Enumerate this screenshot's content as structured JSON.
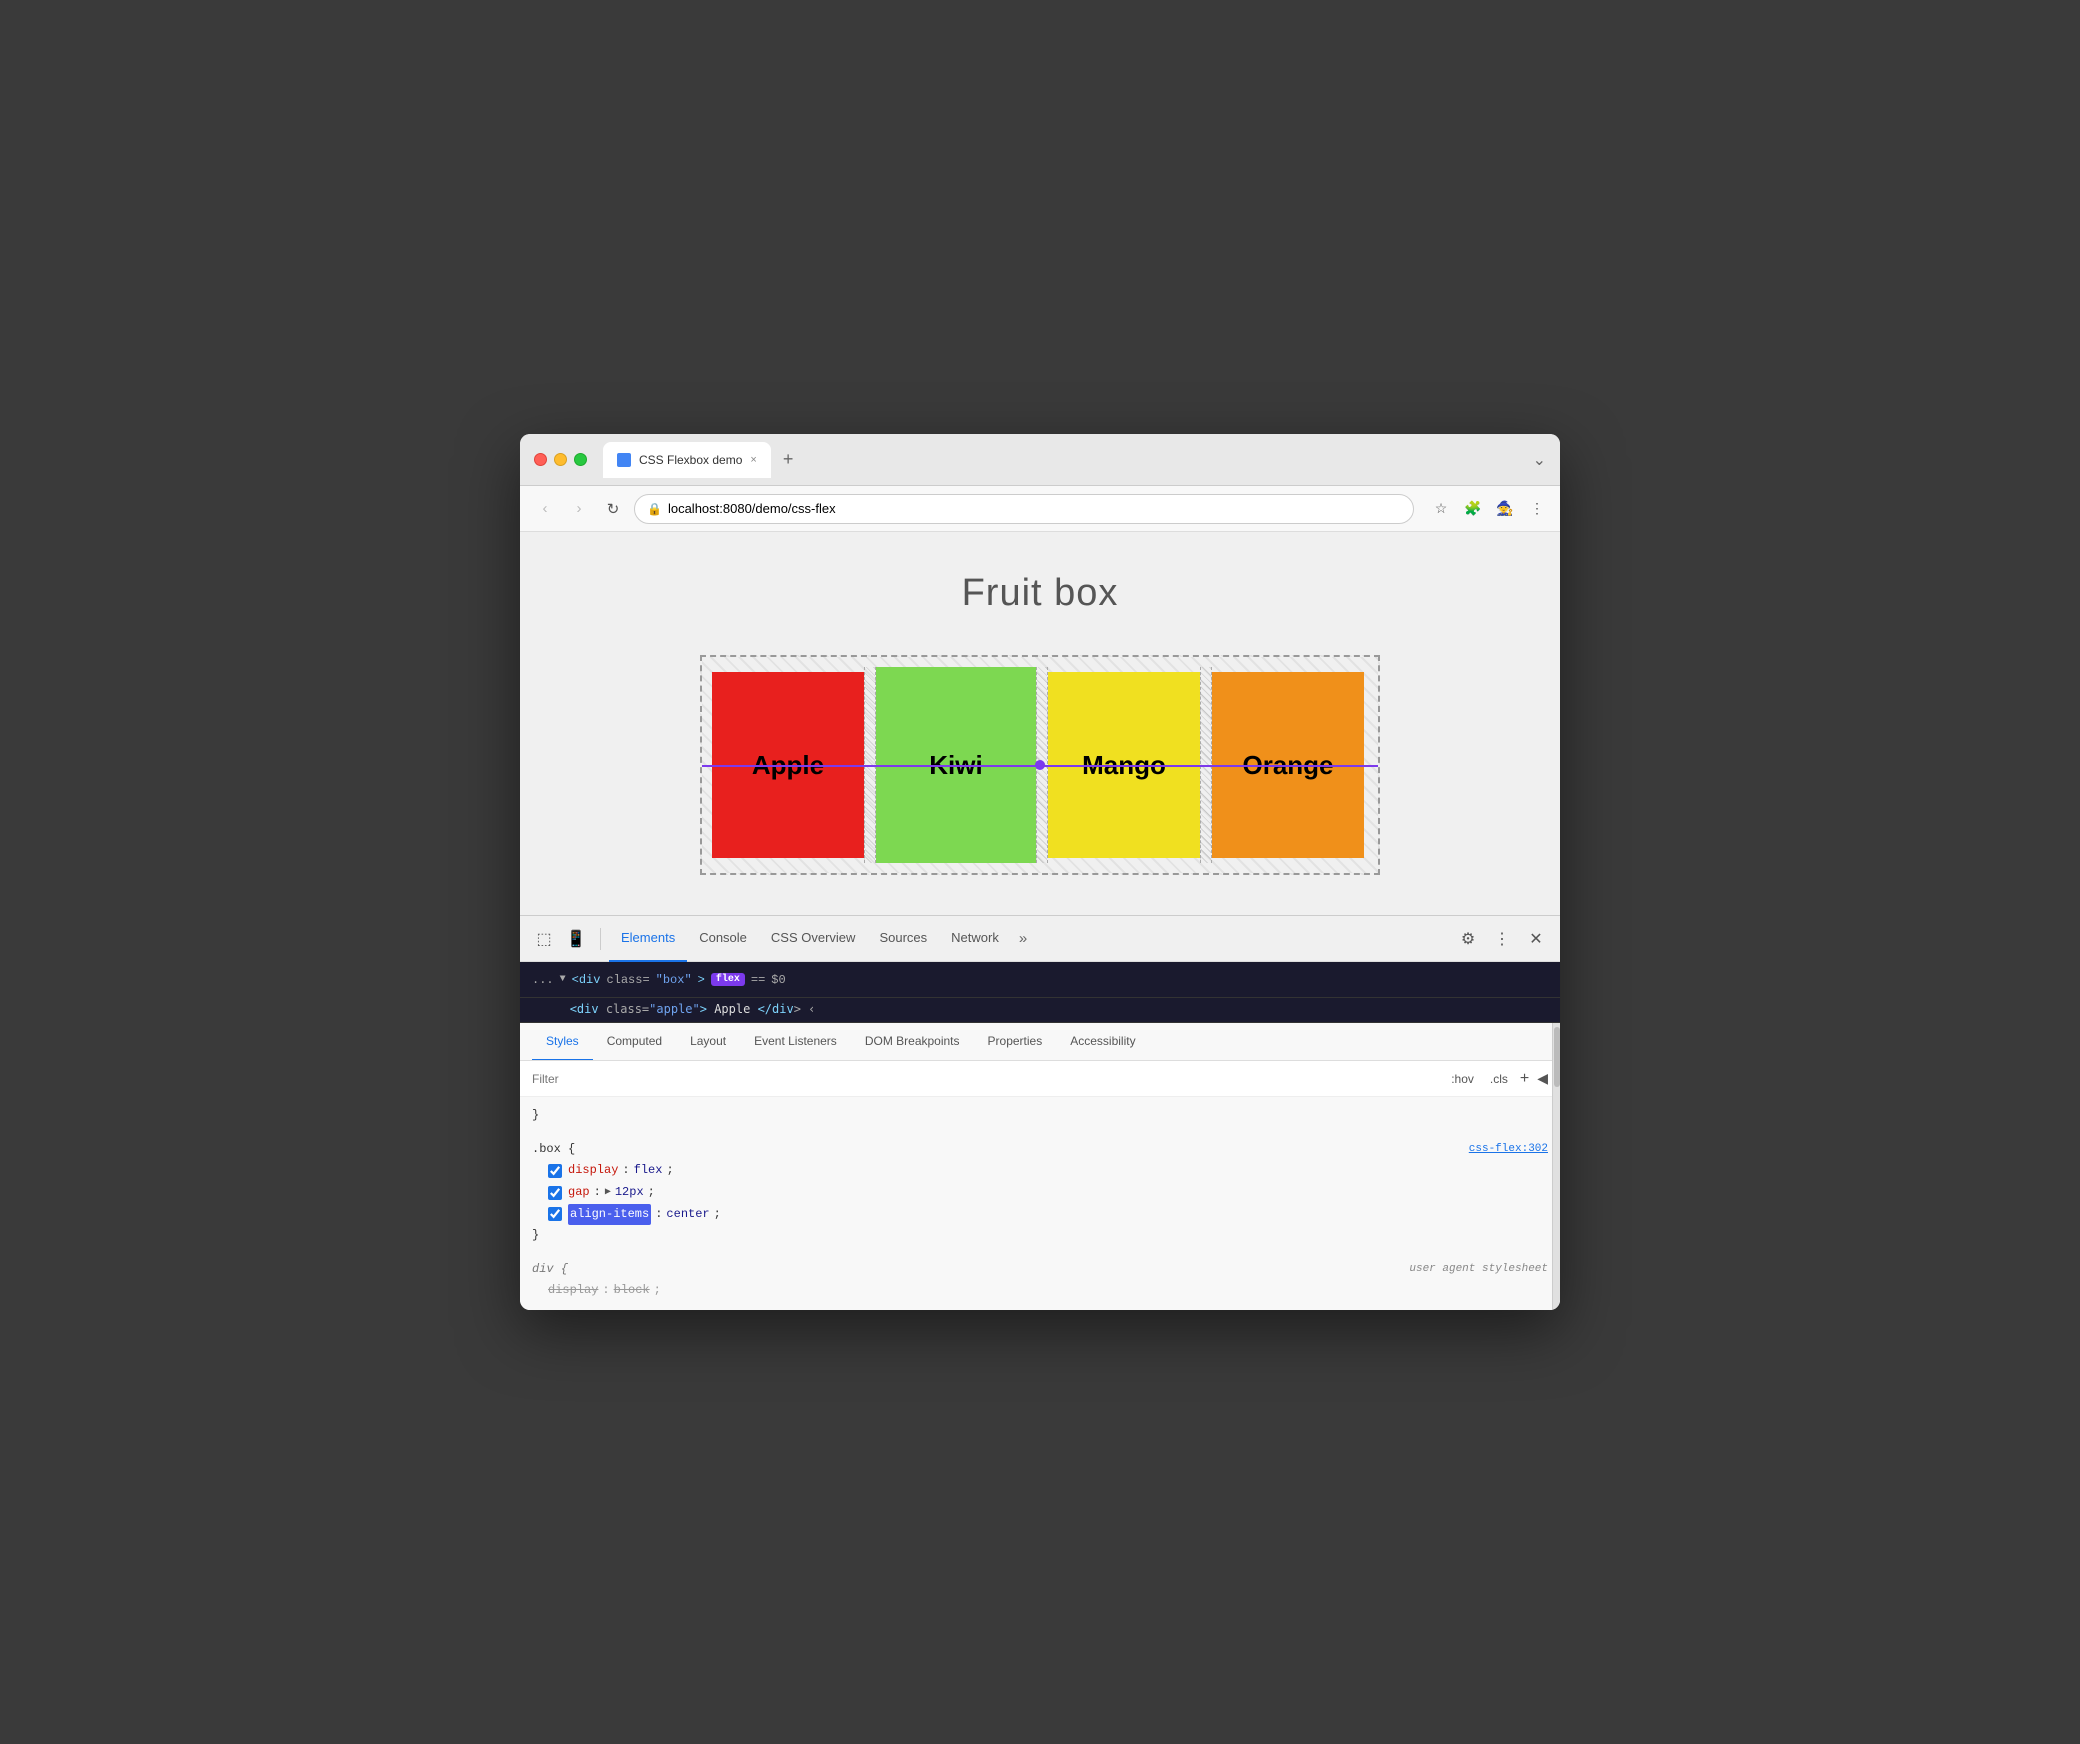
{
  "browser": {
    "tab_title": "CSS Flexbox demo",
    "tab_close": "×",
    "tab_new": "+",
    "tab_overflow": "⌄",
    "url": "localhost:8080/demo/css-flex",
    "url_prefix": "localhost",
    "url_path": ":8080/demo/css-flex"
  },
  "nav": {
    "back": "‹",
    "forward": "›",
    "reload": "↻"
  },
  "page": {
    "title": "Fruit box",
    "fruits": [
      {
        "name": "Apple",
        "color": "#e8201e"
      },
      {
        "name": "Kiwi",
        "color": "#7dd851"
      },
      {
        "name": "Mango",
        "color": "#f0e020"
      },
      {
        "name": "Orange",
        "color": "#f0901a"
      }
    ]
  },
  "devtools": {
    "tabs": [
      "Elements",
      "Console",
      "CSS Overview",
      "Sources",
      "Network"
    ],
    "active_tab": "Elements",
    "overflow": "»",
    "breadcrumb": {
      "dots": "...",
      "tag": "div",
      "attr": "class",
      "val": "box",
      "badge": "flex",
      "eq": "==",
      "dollar": "$0",
      "child_preview": "div class=\"apple\"> Apple </div ‹"
    },
    "subtabs": [
      "Styles",
      "Computed",
      "Layout",
      "Event Listeners",
      "DOM Breakpoints",
      "Properties",
      "Accessibility"
    ],
    "active_subtab": "Styles",
    "filter_placeholder": "Filter",
    "filter_hov": ":hov",
    "filter_cls": ".cls",
    "filter_plus": "+",
    "styles": {
      "empty_rule": "}",
      "box_selector": ".box {",
      "box_source": "css-flex:302",
      "rules": [
        {
          "property": "display",
          "value": "flex",
          "checked": true
        },
        {
          "property": "gap",
          "value": "▶ 12px",
          "checked": true
        },
        {
          "property": "align-items",
          "value": "center",
          "checked": true,
          "highlighted": true
        }
      ],
      "box_close": "}",
      "ua_selector": "div {",
      "ua_label": "user agent stylesheet",
      "ua_rules": [
        {
          "property": "display",
          "value": "block",
          "strikethrough": true
        }
      ],
      "ua_close": "}"
    }
  }
}
